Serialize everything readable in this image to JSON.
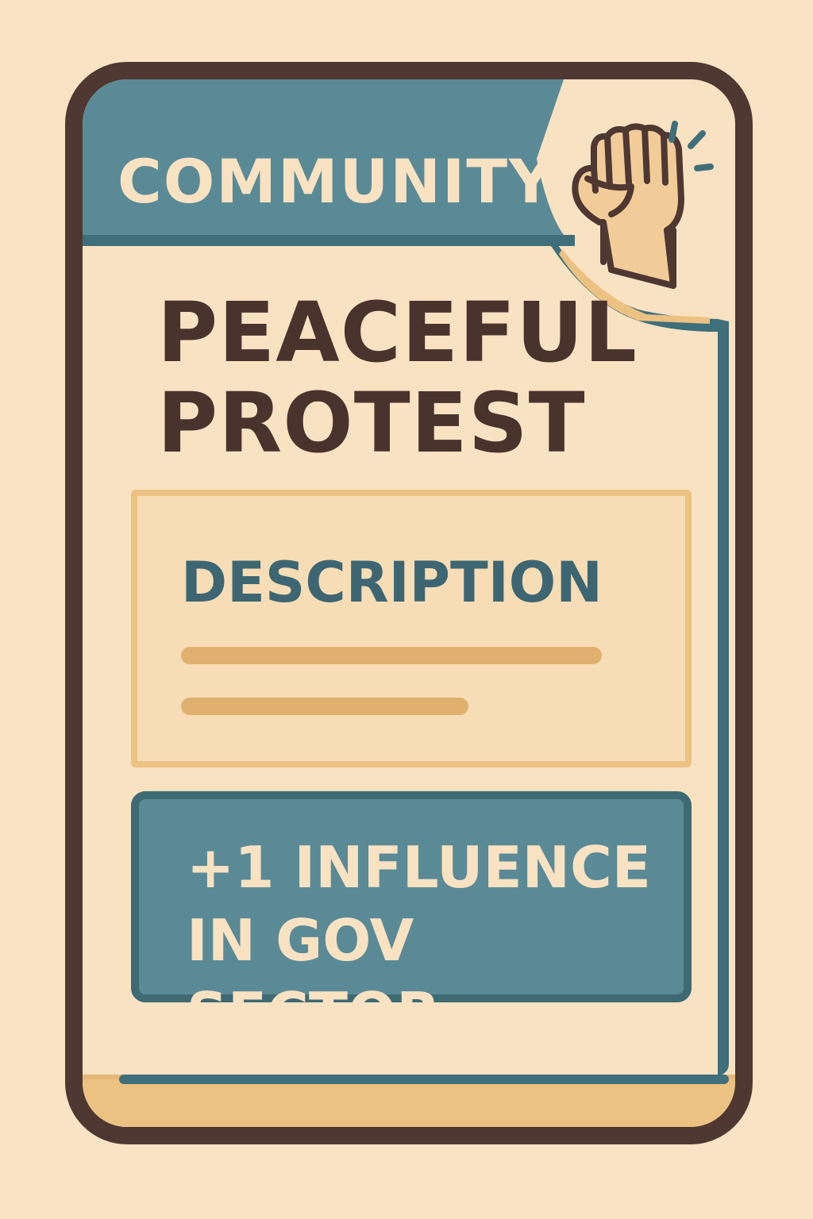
{
  "card": {
    "category": "COMMUNITY",
    "category_icon": "raised-fist-icon",
    "title_line1": "PEACEFUL",
    "title_line2": "PROTEST",
    "description_heading": "DESCRIPTION",
    "effect_line1": "+1 INFLUENCE",
    "effect_line2": "IN GOV SECTOR"
  },
  "colors": {
    "background": "#f9e3c4",
    "border": "#4f3832",
    "header_teal": "#5a8a96",
    "dark_teal": "#3e6a74",
    "tan": "#ecc283",
    "title_brown": "#4a332d"
  }
}
